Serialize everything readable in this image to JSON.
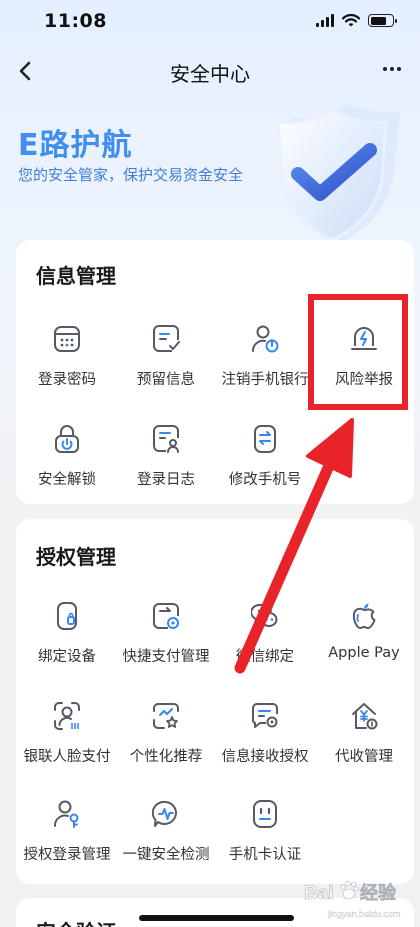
{
  "status_bar": {
    "time": "11:08"
  },
  "nav": {
    "title": "安全中心"
  },
  "hero": {
    "title": "E路护航",
    "subtitle": "您的安全管家，保护交易资金安全"
  },
  "info_section": {
    "title": "信息管理",
    "items": [
      {
        "label": "登录密码",
        "icon": "password-keypad-icon"
      },
      {
        "label": "预留信息",
        "icon": "reserved-info-icon"
      },
      {
        "label": "注销手机银行",
        "icon": "cancel-account-icon"
      },
      {
        "label": "风险举报",
        "icon": "risk-report-icon"
      },
      {
        "label": "安全解锁",
        "icon": "unlock-icon"
      },
      {
        "label": "登录日志",
        "icon": "login-log-icon"
      },
      {
        "label": "修改手机号",
        "icon": "change-phone-icon"
      }
    ]
  },
  "auth_section": {
    "title": "授权管理",
    "items": [
      {
        "label": "绑定设备",
        "icon": "bind-device-icon"
      },
      {
        "label": "快捷支付管理",
        "icon": "quick-pay-icon"
      },
      {
        "label": "微信绑定",
        "icon": "wechat-icon"
      },
      {
        "label": "Apple Pay",
        "icon": "apple-icon"
      },
      {
        "label": "银联人脸支付",
        "icon": "face-pay-icon"
      },
      {
        "label": "个性化推荐",
        "icon": "recommend-icon"
      },
      {
        "label": "信息接收授权",
        "icon": "message-auth-icon"
      },
      {
        "label": "代收管理",
        "icon": "collection-icon"
      },
      {
        "label": "授权登录管理",
        "icon": "auth-login-icon"
      },
      {
        "label": "一键安全检测",
        "icon": "security-check-icon"
      },
      {
        "label": "手机卡认证",
        "icon": "sim-card-icon"
      }
    ]
  },
  "verify_section": {
    "title": "安全验证"
  },
  "colors": {
    "accent": "#3f8ef0",
    "icon_stroke": "#555a66",
    "icon_accent": "#3a86f0",
    "annotation_red": "#e8232a"
  },
  "watermark": {
    "text": "Bai经验",
    "sub": "jingyan.baidu.com"
  }
}
